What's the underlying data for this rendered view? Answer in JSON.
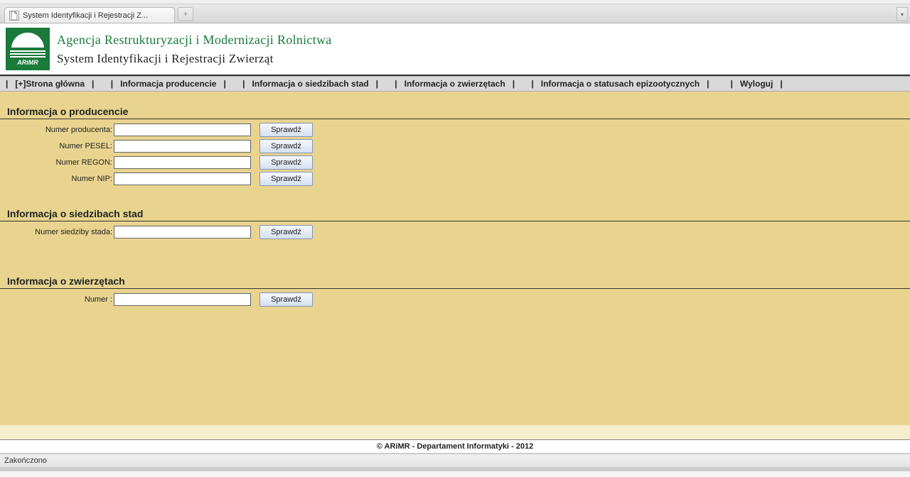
{
  "browser": {
    "tab_title": "System Identyfikacji i Rejestracji Z...",
    "status_text": "Zakończono"
  },
  "header": {
    "logo_text": "ARiMR",
    "agency_name": "Agencja Restrukturyzacji i Modernizacji Rolnictwa",
    "system_name": "System Identyfikacji i Rejestracji Zwierząt"
  },
  "nav": {
    "items": [
      "[+]Strona główna",
      "Informacja producencie",
      "Informacja o siedzibach stad",
      "Informacja o zwierzętach",
      "Informacja o statusach epizootycznych",
      "Wyloguj"
    ]
  },
  "sections": {
    "producer": {
      "title": "Informacja o producencie",
      "rows": [
        {
          "label": "Numer producenta:",
          "button": "Sprawdź"
        },
        {
          "label": "Numer PESEL:",
          "button": "Sprawdź"
        },
        {
          "label": "Numer REGON:",
          "button": "Sprawdź"
        },
        {
          "label": "Numer NIP:",
          "button": "Sprawdź"
        }
      ]
    },
    "herd": {
      "title": "Informacja o siedzibach stad",
      "rows": [
        {
          "label": "Numer siedziby stada:",
          "button": "Sprawdź"
        }
      ]
    },
    "animals": {
      "title": "Informacja o zwierzętach",
      "rows": [
        {
          "label": "Numer :",
          "button": "Sprawdź"
        }
      ]
    }
  },
  "footer": {
    "copyright": "© ARiMR - Departament Informatyki - 2012"
  }
}
